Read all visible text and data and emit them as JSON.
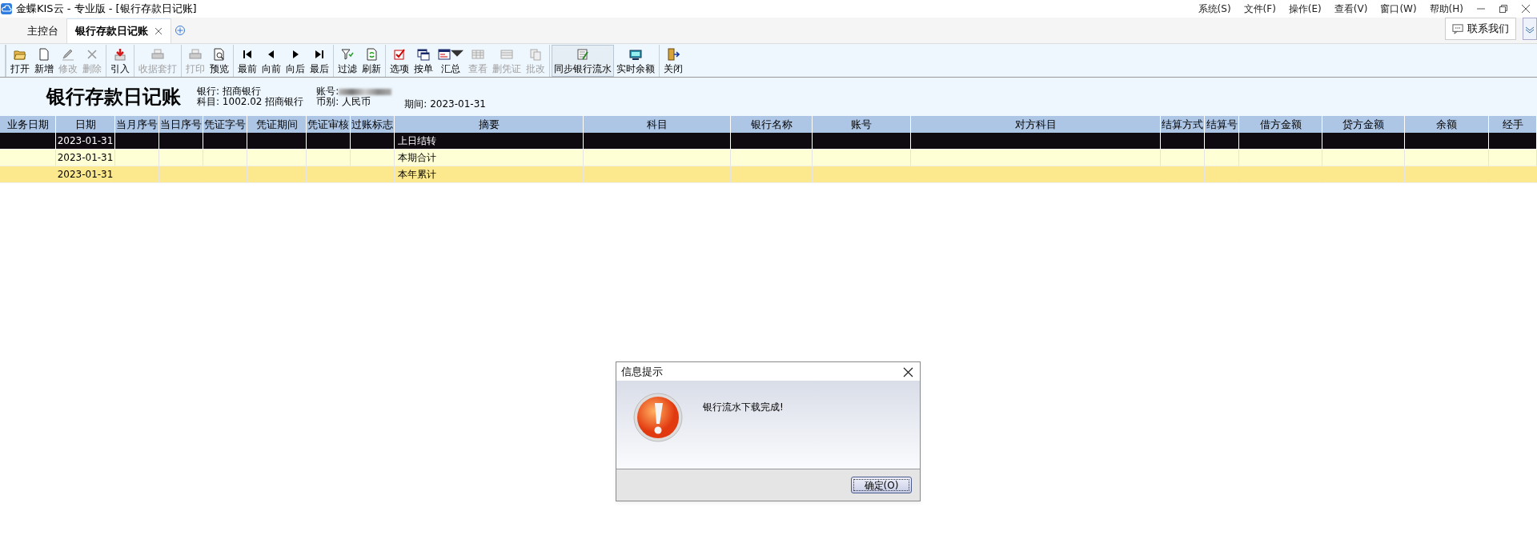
{
  "window": {
    "title": "金蝶KIS云 - 专业版 - [银行存款日记账]"
  },
  "menu": [
    "系统(S)",
    "文件(F)",
    "操作(E)",
    "查看(V)",
    "窗口(W)",
    "帮助(H)"
  ],
  "tabs": [
    {
      "label": "主控台",
      "selected": false,
      "closable": false
    },
    {
      "label": "银行存款日记账",
      "selected": true,
      "closable": true
    }
  ],
  "contact_button": "联系我们",
  "toolbar": [
    [
      {
        "label": "打开",
        "disabled": false,
        "pressed": false
      },
      {
        "label": "新增",
        "disabled": false,
        "pressed": false
      },
      {
        "label": "修改",
        "disabled": true,
        "pressed": false
      },
      {
        "label": "删除",
        "disabled": true,
        "pressed": false
      }
    ],
    [
      {
        "label": "引入",
        "disabled": false,
        "pressed": false
      }
    ],
    [
      {
        "label": "收据套打",
        "disabled": true,
        "pressed": false
      }
    ],
    [
      {
        "label": "打印",
        "disabled": true,
        "pressed": false
      },
      {
        "label": "预览",
        "disabled": false,
        "pressed": false
      }
    ],
    [
      {
        "label": "最前",
        "disabled": false,
        "pressed": false
      },
      {
        "label": "向前",
        "disabled": false,
        "pressed": false
      },
      {
        "label": "向后",
        "disabled": false,
        "pressed": false
      },
      {
        "label": "最后",
        "disabled": false,
        "pressed": false
      }
    ],
    [
      {
        "label": "过滤",
        "disabled": false,
        "pressed": false
      },
      {
        "label": "刷新",
        "disabled": false,
        "pressed": false
      }
    ],
    [
      {
        "label": "选项",
        "disabled": false,
        "pressed": false
      },
      {
        "label": "按单",
        "disabled": false,
        "pressed": false
      },
      {
        "label": "汇总",
        "disabled": false,
        "pressed": false,
        "dropdown": true
      },
      {
        "label": "查看",
        "disabled": true,
        "pressed": false
      },
      {
        "label": "删凭证",
        "disabled": true,
        "pressed": false
      },
      {
        "label": "批改",
        "disabled": true,
        "pressed": false
      }
    ],
    [
      {
        "label": "同步银行流水",
        "disabled": false,
        "pressed": true
      },
      {
        "label": "实时余额",
        "disabled": false,
        "pressed": false
      }
    ],
    [
      {
        "label": "关闭",
        "disabled": false,
        "pressed": false
      }
    ]
  ],
  "report": {
    "title": "银行存款日记账",
    "fields": [
      {
        "label": "银行:",
        "value": "招商银行"
      },
      {
        "label": "科目:",
        "value": "1002.02 招商银行"
      },
      {
        "label": "账号:",
        "redacted": true
      },
      {
        "label": "币别:",
        "value": "人民币"
      },
      {
        "label": "期间:",
        "value": "2023-01-31"
      }
    ]
  },
  "table": {
    "columns": [
      "业务日期",
      "日期",
      "当月序号",
      "当日序号",
      "凭证字号",
      "凭证期间",
      "凭证审核",
      "过账标志",
      "摘要",
      "科目",
      "银行名称",
      "账号",
      "对方科目",
      "结算方式",
      "结算号",
      "借方金额",
      "贷方金额",
      "余额",
      "经手"
    ],
    "rows": [
      {
        "selected": true,
        "date": "2023-01-31",
        "summary": "上日结转"
      },
      {
        "selected": false,
        "color": "#ffffd5",
        "date": "2023-01-31",
        "summary": "本期合计"
      },
      {
        "selected": false,
        "color": "#fde98d",
        "date": "2023-01-31",
        "summary": "本年累计"
      }
    ]
  },
  "dialog": {
    "title": "信息提示",
    "message": "银行流水下载完成!",
    "button": "确定(O)"
  }
}
